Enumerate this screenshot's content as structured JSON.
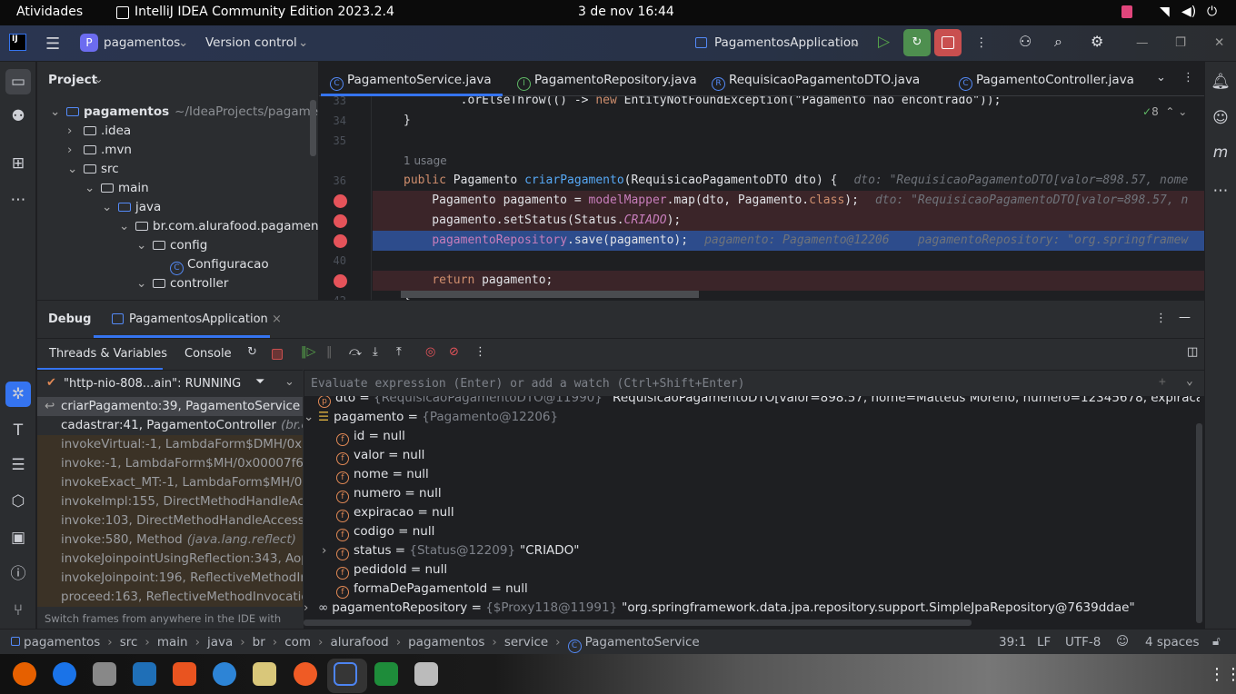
{
  "gnome": {
    "activities": "Atividades",
    "app": "IntelliJ IDEA Community Edition 2023.2.4",
    "clock": "3 de nov  16:44"
  },
  "header": {
    "project": "pagamentos",
    "project_badge": "P",
    "vcs": "Version control",
    "run_config": "PagamentosApplication"
  },
  "project_panel": {
    "title": "Project",
    "items": [
      {
        "label": "pagamentos",
        "extra": "~/IdeaProjects/pagamentos",
        "depth": 0,
        "open": true,
        "type": "module"
      },
      {
        "label": ".idea",
        "depth": 1,
        "open": false,
        "type": "folder"
      },
      {
        "label": ".mvn",
        "depth": 1,
        "open": false,
        "type": "folder"
      },
      {
        "label": "src",
        "depth": 1,
        "open": true,
        "type": "folder"
      },
      {
        "label": "main",
        "depth": 2,
        "open": true,
        "type": "folder"
      },
      {
        "label": "java",
        "depth": 3,
        "open": true,
        "type": "source"
      },
      {
        "label": "br.com.alurafood.pagamentos",
        "depth": 4,
        "open": true,
        "type": "package"
      },
      {
        "label": "config",
        "depth": 5,
        "open": true,
        "type": "package"
      },
      {
        "label": "Configuracao",
        "depth": 6,
        "type": "class"
      },
      {
        "label": "controller",
        "depth": 5,
        "open": true,
        "type": "package"
      }
    ]
  },
  "tabs": [
    {
      "label": "PagamentoService.java",
      "icon": "C",
      "active": true
    },
    {
      "label": "PagamentoRepository.java",
      "icon": "I"
    },
    {
      "label": "RequisicaoPagamentoDTO.java",
      "icon": "R"
    },
    {
      "label": "PagamentoController.java",
      "icon": "C"
    }
  ],
  "editor": {
    "inspections": "8",
    "usage": "1 usage",
    "lines": [
      {
        "n": "33",
        "code": [
          [
            "plain",
            "        .orElseThrow(() -> "
          ],
          [
            "kw",
            "new "
          ],
          [
            "plain",
            "EntityNotFoundException(\"Pagamento não encontrado\"));"
          ]
        ]
      },
      {
        "n": "34",
        "code": [
          [
            "plain",
            "}"
          ]
        ]
      },
      {
        "n": "35",
        "code": []
      },
      {
        "n": "",
        "usage": true
      },
      {
        "n": "36",
        "code": [
          [
            "kw",
            "public "
          ],
          [
            "plain",
            "Pagamento "
          ],
          [
            "fn",
            "criarPagamento"
          ],
          [
            "plain",
            "(RequisicaoPagamentoDTO dto) {"
          ]
        ],
        "hint": "dto: \"RequisicaoPagamentoDTO[valor=898.57, nome"
      },
      {
        "n": "",
        "bp": true,
        "code": [
          [
            "plain",
            "    Pagamento pagamento = "
          ],
          [
            "fd",
            "modelMapper"
          ],
          [
            "plain",
            ".map(dto, Pagamento."
          ],
          [
            "kw",
            "class"
          ],
          [
            "plain",
            ");"
          ]
        ],
        "hint": "dto: \"RequisicaoPagamentoDTO[valor=898.57, n"
      },
      {
        "n": "",
        "bp": true,
        "code": [
          [
            "plain",
            "    pagamento.setStatus(Status."
          ],
          [
            "fd it",
            "CRIADO"
          ],
          [
            "plain",
            ");"
          ]
        ]
      },
      {
        "n": "",
        "bp": true,
        "current": true,
        "code": [
          [
            "plain",
            "    "
          ],
          [
            "fd",
            "pagamentoRepository"
          ],
          [
            "plain",
            ".save(pagamento);"
          ]
        ],
        "hint": "pagamento: Pagamento@12206    pagamentoRepository: \"org.springframew"
      },
      {
        "n": "40",
        "code": []
      },
      {
        "n": "",
        "bp": true,
        "code": [
          [
            "plain",
            "    "
          ],
          [
            "kw",
            "return "
          ],
          [
            "plain",
            "pagamento;"
          ]
        ]
      },
      {
        "n": "42",
        "code": [
          [
            "plain",
            "}"
          ]
        ]
      }
    ]
  },
  "debug": {
    "title": "Debug",
    "session": "PagamentosApplication",
    "subtabs": [
      "Threads & Variables",
      "Console"
    ],
    "thread": "\"http-nio-808...ain\": RUNNING",
    "eval_placeholder": "Evaluate expression (Enter) or add a watch (Ctrl+Shift+Enter)",
    "frames": [
      {
        "m": "criarPagamento:39, PagamentoService",
        "p": "(br.",
        "sel": true
      },
      {
        "m": "cadastrar:41, PagamentoController",
        "p": "(br.com"
      },
      {
        "m": "invokeVirtual:-1, LambdaForm$DMH/0x000",
        "lib": true
      },
      {
        "m": "invoke:-1, LambdaForm$MH/0x00007f6bb8",
        "lib": true
      },
      {
        "m": "invokeExact_MT:-1, LambdaForm$MH/0x00",
        "lib": true
      },
      {
        "m": "invokeImpl:155, DirectMethodHandleAcces",
        "lib": true
      },
      {
        "m": "invoke:103, DirectMethodHandleAccessor",
        "lib": true
      },
      {
        "m": "invoke:580, Method",
        "p": "(java.lang.reflect)",
        "lib": true
      },
      {
        "m": "invokeJoinpointUsingReflection:343, AopU",
        "lib": true
      },
      {
        "m": "invokeJoinpoint:196, ReflectiveMethodInvo",
        "lib": true
      },
      {
        "m": "proceed:163, ReflectiveMethodInvocation",
        "lib": true
      }
    ],
    "hint": "Switch frames from anywhere in the IDE with Alt...",
    "vars": [
      {
        "d": 0,
        "exp": ">",
        "icon": "p",
        "name": "dto",
        "ref": "{RequisicaoPagamentoDTO@11990}",
        "val": "\"RequisicaoPagamentoDTO[valor=898.57, nome=Matteus Moreno, numero=12345678, expiracao= ...",
        "link": "View"
      },
      {
        "d": 0,
        "exp": "v",
        "icon": "obj",
        "name": "pagamento",
        "ref": "{Pagamento@12206}"
      },
      {
        "d": 1,
        "icon": "f",
        "name": "id",
        "val": "null"
      },
      {
        "d": 1,
        "icon": "f",
        "name": "valor",
        "val": "null"
      },
      {
        "d": 1,
        "icon": "f",
        "name": "nome",
        "val": "null"
      },
      {
        "d": 1,
        "icon": "f",
        "name": "numero",
        "val": "null"
      },
      {
        "d": 1,
        "icon": "f",
        "name": "expiracao",
        "val": "null"
      },
      {
        "d": 1,
        "icon": "f",
        "name": "codigo",
        "val": "null"
      },
      {
        "d": 1,
        "exp": ">",
        "icon": "f",
        "name": "status",
        "ref": "{Status@12209}",
        "val": "\"CRIADO\""
      },
      {
        "d": 1,
        "icon": "f",
        "name": "pedidoId",
        "val": "null"
      },
      {
        "d": 1,
        "icon": "f",
        "name": "formaDePagamentoId",
        "val": "null"
      },
      {
        "d": 0,
        "exp": ">",
        "icon": "oo",
        "name": "pagamentoRepository",
        "ref": "{$Proxy118@11991}",
        "val": "\"org.springframework.data.jpa.repository.support.SimpleJpaRepository@7639ddae\""
      }
    ]
  },
  "status": {
    "breadcrumb": [
      "pagamentos",
      "src",
      "main",
      "java",
      "br",
      "com",
      "alurafood",
      "pagamentos",
      "service",
      "PagamentoService"
    ],
    "position": "39:1",
    "line_sep": "LF",
    "encoding": "UTF-8",
    "indent": "4 spaces"
  },
  "colors": {
    "accent": "#3574f0",
    "breakpoint": "#e5535a",
    "current_line": "#2d4c8c",
    "bp_line": "#3b2529",
    "frame_lib": "#3b3226"
  },
  "taskbar": [
    "firefox",
    "thunderbird",
    "files",
    "writer",
    "app-center",
    "help",
    "rhythmbox",
    "postman",
    "intellij",
    "calc",
    "trash"
  ]
}
